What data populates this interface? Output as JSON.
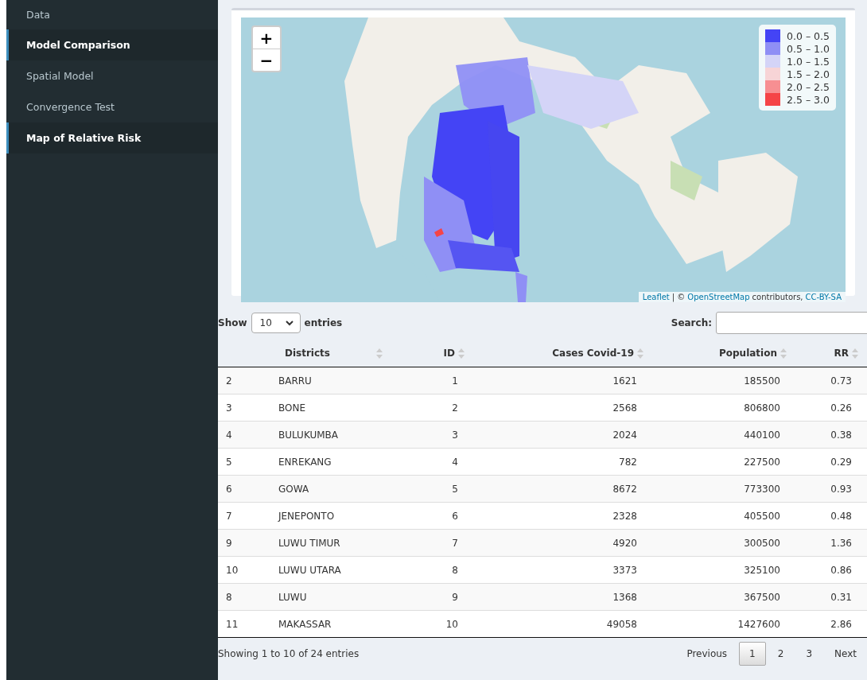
{
  "sidebar": {
    "items": [
      {
        "label": "Data",
        "selected": false
      },
      {
        "label": "Model Comparison",
        "selected": true
      },
      {
        "label": "Spatial Model",
        "selected": false
      },
      {
        "label": "Convergence Test",
        "selected": false
      },
      {
        "label": "Map of Relative Risk",
        "selected": true
      }
    ]
  },
  "map": {
    "zoom_in": "+",
    "zoom_out": "−",
    "legend": [
      {
        "label": "0.0 – 0.5",
        "color": "#4444f5"
      },
      {
        "label": "0.5 – 1.0",
        "color": "#8f8ff5"
      },
      {
        "label": "1.0 – 1.5",
        "color": "#d4d4f7"
      },
      {
        "label": "1.5 – 2.0",
        "color": "#f7d4d6"
      },
      {
        "label": "2.0 – 2.5",
        "color": "#f78f92"
      },
      {
        "label": "2.5 – 3.0",
        "color": "#f54447"
      }
    ],
    "attribution": {
      "link1": "Leaflet",
      "sep": "| ©",
      "link2": "OpenStreetMap",
      "text": "contributors,",
      "link3": "CC-BY-SA"
    }
  },
  "table": {
    "length_label_before": "Show",
    "length_value": "10",
    "length_label_after": "entries",
    "search_label": "Search:",
    "columns": [
      "",
      "Districts",
      "ID",
      "Cases Covid-19",
      "Population",
      "RR"
    ],
    "rows": [
      [
        "2",
        "BARRU",
        "1",
        "1621",
        "185500",
        "0.73"
      ],
      [
        "3",
        "BONE",
        "2",
        "2568",
        "806800",
        "0.26"
      ],
      [
        "4",
        "BULUKUMBA",
        "3",
        "2024",
        "440100",
        "0.38"
      ],
      [
        "5",
        "ENREKANG",
        "4",
        "782",
        "227500",
        "0.29"
      ],
      [
        "6",
        "GOWA",
        "5",
        "8672",
        "773300",
        "0.93"
      ],
      [
        "7",
        "JENEPONTO",
        "6",
        "2328",
        "405500",
        "0.48"
      ],
      [
        "9",
        "LUWU TIMUR",
        "7",
        "4920",
        "300500",
        "1.36"
      ],
      [
        "10",
        "LUWU UTARA",
        "8",
        "3373",
        "325100",
        "0.86"
      ],
      [
        "8",
        "LUWU",
        "9",
        "1368",
        "367500",
        "0.31"
      ],
      [
        "11",
        "MAKASSAR",
        "10",
        "49058",
        "1427600",
        "2.86"
      ]
    ],
    "info": "Showing 1 to 10 of 24 entries",
    "pagination": {
      "previous": "Previous",
      "pages": [
        {
          "label": "1",
          "selected": true
        },
        {
          "label": "2",
          "selected": false
        },
        {
          "label": "3",
          "selected": false
        }
      ],
      "next": "Next"
    }
  }
}
